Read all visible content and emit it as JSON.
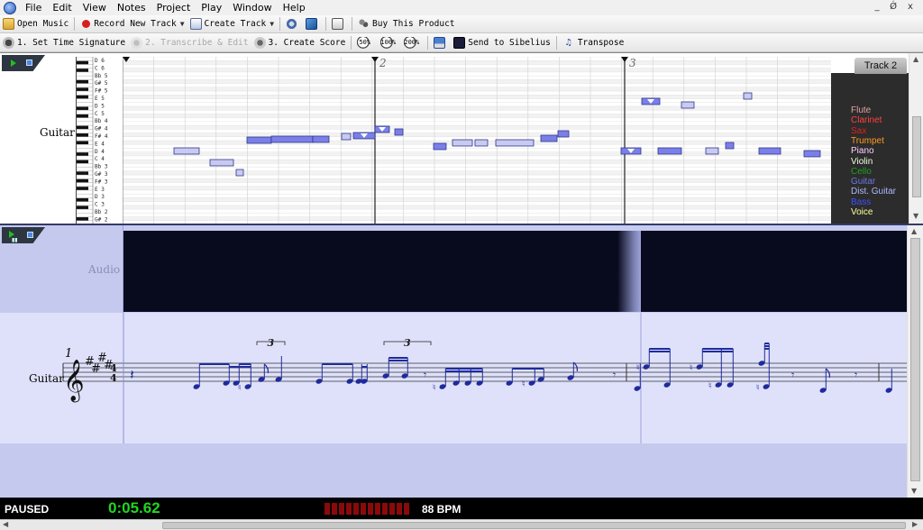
{
  "menubar": {
    "items": [
      "File",
      "Edit",
      "View",
      "Notes",
      "Project",
      "Play",
      "Window",
      "Help"
    ],
    "win_min": "_",
    "win_restore": "Ǿ",
    "win_close": "x"
  },
  "toolbar1": {
    "open_music": "Open Music",
    "record_new_track": "Record New Track",
    "create_track": "Create Track",
    "buy_product": "Buy This Product"
  },
  "toolbar2": {
    "set_time_signature": "1. Set Time Signature",
    "transcribe_edit": "2. Transcribe & Edit",
    "create_score": "3. Create Score",
    "zoom_50": "50%",
    "zoom_100": "100%",
    "zoom_200": "200%",
    "send_to_sibelius": "Send to Sibelius",
    "transpose": "Transpose"
  },
  "piano_roll": {
    "track_label": "Guitar",
    "track_tab": "Track 2",
    "measure_numbers": [
      "2",
      "3"
    ],
    "key_labels": [
      "D 6",
      "C 6",
      "Bb 5",
      "G# 5",
      "F# 5",
      "E 5",
      "D 5",
      "C 5",
      "Bb 4",
      "G# 4",
      "F# 4",
      "E 4",
      "D 4",
      "C 4",
      "Bb 3",
      "G# 3",
      "F# 3",
      "E 3",
      "D 3",
      "C 3",
      "Bb 2",
      "G# 2"
    ],
    "instruments": [
      {
        "name": "Flute",
        "color": "#e0a0a0"
      },
      {
        "name": "Clarinet",
        "color": "#ff4040"
      },
      {
        "name": "Sax",
        "color": "#e02020"
      },
      {
        "name": "Trumpet",
        "color": "#ff9a20"
      },
      {
        "name": "Piano",
        "color": "#ffd0ff"
      },
      {
        "name": "Violin",
        "color": "#f0ffe0"
      },
      {
        "name": "Cello",
        "color": "#20a020"
      },
      {
        "name": "Guitar",
        "color": "#6a78e0"
      },
      {
        "name": "Dist. Guitar",
        "color": "#b0b8ff"
      },
      {
        "name": "Bass",
        "color": "#4050ff"
      },
      {
        "name": "Voice",
        "color": "#ffffa0"
      }
    ]
  },
  "score": {
    "audio_label": "Audio",
    "track_label": "Guitar",
    "measure_number": "1",
    "time_signature_top": "4",
    "time_signature_bottom": "4",
    "tuplet_label": "3"
  },
  "status": {
    "state": "PAUSED",
    "time": "0:05.62",
    "tempo": "88 BPM"
  },
  "colors": {
    "note_fill": "#7a80e8",
    "note_light": "#c8caf0",
    "score_ink": "#1f2b9a",
    "time_green": "#22d622"
  }
}
